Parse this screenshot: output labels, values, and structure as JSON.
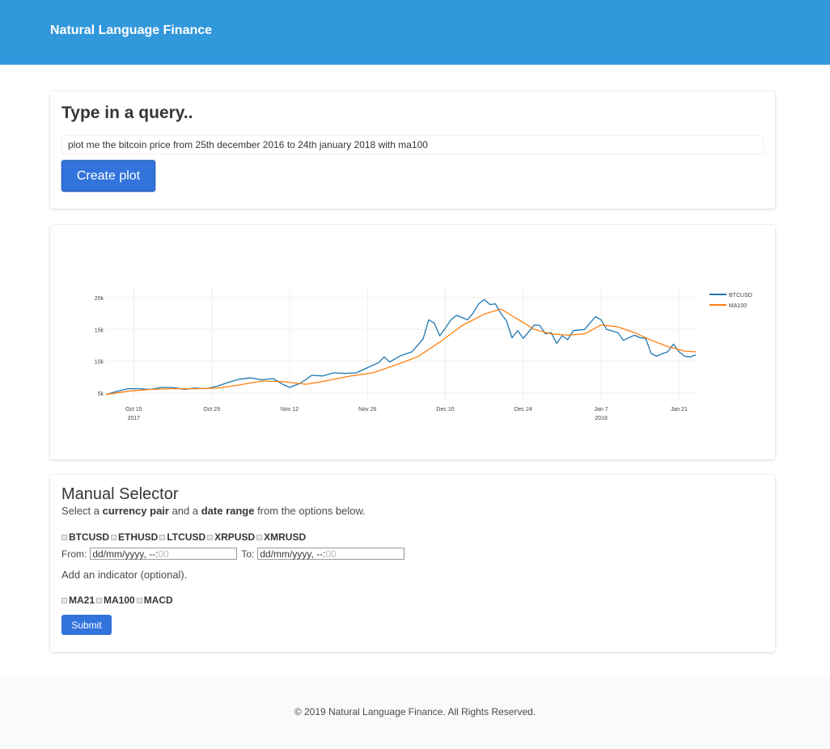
{
  "navbar": {
    "brand": "Natural Language Finance"
  },
  "query": {
    "title": "Type in a query..",
    "value": "plot me the bitcoin price from 25th december 2016 to 24th january 2018 with ma100",
    "button": "Create plot"
  },
  "chart_data": {
    "type": "line",
    "title": "",
    "xlabel": "",
    "ylabel": "",
    "x_ticks": [
      {
        "label": "Oct 15",
        "sub": "2017",
        "day": 0
      },
      {
        "label": "Oct 29",
        "sub": "",
        "day": 14
      },
      {
        "label": "Nov 12",
        "sub": "",
        "day": 28
      },
      {
        "label": "Nov 26",
        "sub": "",
        "day": 42
      },
      {
        "label": "Dec 10",
        "sub": "",
        "day": 56
      },
      {
        "label": "Dec 24",
        "sub": "",
        "day": 70
      },
      {
        "label": "Jan 7",
        "sub": "2018",
        "day": 84
      },
      {
        "label": "Jan 21",
        "sub": "",
        "day": 98
      }
    ],
    "y_ticks": [
      {
        "label": "5k",
        "value": 5000
      },
      {
        "label": "10k",
        "value": 10000
      },
      {
        "label": "15k",
        "value": 15000
      },
      {
        "label": "20k",
        "value": 20000
      }
    ],
    "xlim": [
      "2017-10-10",
      "2018-01-24"
    ],
    "ylim": [
      4000,
      21500
    ],
    "grid": true,
    "legend_position": "top-right",
    "series": [
      {
        "name": "BTCUSD",
        "color": "#1f77b4",
        "points": [
          [
            "2017-10-10",
            4800
          ],
          [
            "2017-10-12",
            5300
          ],
          [
            "2017-10-14",
            5700
          ],
          [
            "2017-10-16",
            5700
          ],
          [
            "2017-10-18",
            5600
          ],
          [
            "2017-10-20",
            5900
          ],
          [
            "2017-10-22",
            5900
          ],
          [
            "2017-10-24",
            5600
          ],
          [
            "2017-10-26",
            5800
          ],
          [
            "2017-10-28",
            5700
          ],
          [
            "2017-10-30",
            6100
          ],
          [
            "2017-11-01",
            6700
          ],
          [
            "2017-11-03",
            7200
          ],
          [
            "2017-11-05",
            7400
          ],
          [
            "2017-11-07",
            7100
          ],
          [
            "2017-11-09",
            7300
          ],
          [
            "2017-11-11",
            6300
          ],
          [
            "2017-11-12",
            5900
          ],
          [
            "2017-11-14",
            6600
          ],
          [
            "2017-11-16",
            7800
          ],
          [
            "2017-11-18",
            7700
          ],
          [
            "2017-11-20",
            8200
          ],
          [
            "2017-11-22",
            8100
          ],
          [
            "2017-11-24",
            8200
          ],
          [
            "2017-11-26",
            9000
          ],
          [
            "2017-11-28",
            9800
          ],
          [
            "2017-11-29",
            10700
          ],
          [
            "2017-11-30",
            9900
          ],
          [
            "2017-12-02",
            10900
          ],
          [
            "2017-12-04",
            11500
          ],
          [
            "2017-12-06",
            13500
          ],
          [
            "2017-12-07",
            16500
          ],
          [
            "2017-12-08",
            16000
          ],
          [
            "2017-12-09",
            14000
          ],
          [
            "2017-12-10",
            15200
          ],
          [
            "2017-12-11",
            16500
          ],
          [
            "2017-12-12",
            17200
          ],
          [
            "2017-12-14",
            16500
          ],
          [
            "2017-12-15",
            17600
          ],
          [
            "2017-12-16",
            19000
          ],
          [
            "2017-12-17",
            19700
          ],
          [
            "2017-12-18",
            18900
          ],
          [
            "2017-12-19",
            19000
          ],
          [
            "2017-12-20",
            17500
          ],
          [
            "2017-12-21",
            16300
          ],
          [
            "2017-12-22",
            13700
          ],
          [
            "2017-12-23",
            14800
          ],
          [
            "2017-12-24",
            13600
          ],
          [
            "2017-12-26",
            15700
          ],
          [
            "2017-12-27",
            15600
          ],
          [
            "2017-12-28",
            14300
          ],
          [
            "2017-12-29",
            14500
          ],
          [
            "2017-12-30",
            12800
          ],
          [
            "2017-12-31",
            14000
          ],
          [
            "2018-01-01",
            13400
          ],
          [
            "2018-01-02",
            14800
          ],
          [
            "2018-01-04",
            15000
          ],
          [
            "2018-01-06",
            17000
          ],
          [
            "2018-01-07",
            16500
          ],
          [
            "2018-01-08",
            15000
          ],
          [
            "2018-01-10",
            14500
          ],
          [
            "2018-01-11",
            13300
          ],
          [
            "2018-01-13",
            14100
          ],
          [
            "2018-01-14",
            13700
          ],
          [
            "2018-01-15",
            13600
          ],
          [
            "2018-01-16",
            11200
          ],
          [
            "2018-01-17",
            10800
          ],
          [
            "2018-01-18",
            11200
          ],
          [
            "2018-01-19",
            11500
          ],
          [
            "2018-01-20",
            12700
          ],
          [
            "2018-01-21",
            11500
          ],
          [
            "2018-01-22",
            10800
          ],
          [
            "2018-01-23",
            10700
          ],
          [
            "2018-01-24",
            11000
          ]
        ]
      },
      {
        "name": "MA100",
        "color": "#ff7f0e",
        "points": [
          [
            "2017-10-10",
            4800
          ],
          [
            "2017-10-14",
            5300
          ],
          [
            "2017-10-18",
            5600
          ],
          [
            "2017-10-22",
            5700
          ],
          [
            "2017-10-26",
            5700
          ],
          [
            "2017-10-30",
            5800
          ],
          [
            "2017-11-03",
            6300
          ],
          [
            "2017-11-07",
            6900
          ],
          [
            "2017-11-11",
            6800
          ],
          [
            "2017-11-15",
            6400
          ],
          [
            "2017-11-19",
            7000
          ],
          [
            "2017-11-23",
            7700
          ],
          [
            "2017-11-27",
            8200
          ],
          [
            "2017-12-01",
            9400
          ],
          [
            "2017-12-05",
            10700
          ],
          [
            "2017-12-09",
            13000
          ],
          [
            "2017-12-13",
            15600
          ],
          [
            "2017-12-17",
            17400
          ],
          [
            "2017-12-20",
            18200
          ],
          [
            "2017-12-23",
            16600
          ],
          [
            "2017-12-26",
            15000
          ],
          [
            "2017-12-29",
            14300
          ],
          [
            "2018-01-01",
            14100
          ],
          [
            "2018-01-04",
            14300
          ],
          [
            "2018-01-07",
            15700
          ],
          [
            "2018-01-10",
            15400
          ],
          [
            "2018-01-13",
            14500
          ],
          [
            "2018-01-16",
            13300
          ],
          [
            "2018-01-19",
            12300
          ],
          [
            "2018-01-22",
            11600
          ],
          [
            "2018-01-24",
            11500
          ]
        ]
      }
    ]
  },
  "manual": {
    "title": "Manual Selector",
    "desc_pre": "Select a ",
    "desc_b1": "currency pair",
    "desc_mid": " and a ",
    "desc_b2": "date range",
    "desc_post": " from the options below.",
    "pairs": [
      "BTCUSD",
      "ETHUSD",
      "LTCUSD",
      "XRPUSD",
      "XMRUSD"
    ],
    "from_label": "From:",
    "to_label": "To:",
    "date_placeholder": "dd/mm/yyyy, --:",
    "time_placeholder": "00",
    "indicator_hint": "Add an indicator (optional).",
    "indicators": [
      "MA21",
      "MA100",
      "MACD"
    ],
    "submit": "Submit"
  },
  "footer": {
    "copyright": "© 2019 Natural Language Finance. All Rights Reserved."
  }
}
